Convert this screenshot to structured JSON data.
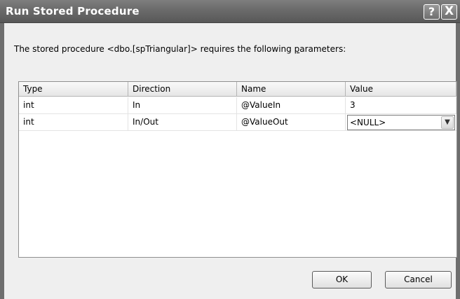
{
  "dialog": {
    "title": "Run Stored Procedure",
    "help_glyph": "?",
    "close_glyph": "X"
  },
  "prompt": {
    "before": "The stored procedure <dbo.[spTriangular]> requires the following ",
    "underlined": "p",
    "after": "arameters:"
  },
  "grid": {
    "headers": [
      "Type",
      "Direction",
      "Name",
      "Value"
    ],
    "rows": [
      {
        "type": "int",
        "direction": "In",
        "name": "@ValueIn",
        "value": "3"
      },
      {
        "type": "int",
        "direction": "In/Out",
        "name": "@ValueOut",
        "value": "<NULL>"
      }
    ],
    "dropdown_glyph": "▼"
  },
  "buttons": {
    "ok": "OK",
    "cancel": "Cancel"
  }
}
